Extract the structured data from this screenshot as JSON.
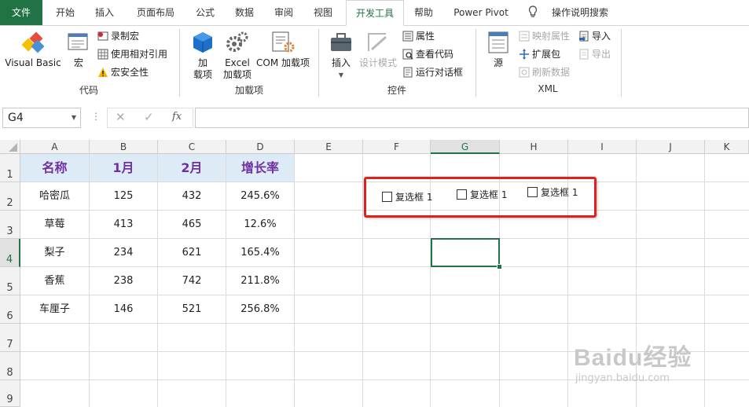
{
  "tabs": [
    {
      "label": "文件"
    },
    {
      "label": "开始"
    },
    {
      "label": "插入"
    },
    {
      "label": "页面布局"
    },
    {
      "label": "公式"
    },
    {
      "label": "数据"
    },
    {
      "label": "审阅"
    },
    {
      "label": "视图"
    },
    {
      "label": "开发工具"
    },
    {
      "label": "帮助"
    },
    {
      "label": "Power Pivot"
    }
  ],
  "tell_me": "操作说明搜索",
  "ribbon": {
    "code": {
      "group_label": "代码",
      "visual_basic": "Visual Basic",
      "macros": "宏",
      "record_macro": "录制宏",
      "relative_ref": "使用相对引用",
      "macro_security": "宏安全性"
    },
    "addins": {
      "group_label": "加载项",
      "addins_line1": "加",
      "addins_line2": "载项",
      "excel_line1": "Excel",
      "excel_line2": "加载项",
      "com": "COM 加载项"
    },
    "controls": {
      "group_label": "控件",
      "insert": "插入",
      "design_mode": "设计模式",
      "properties": "属性",
      "view_code": "查看代码",
      "run_dialog": "运行对话框"
    },
    "xml": {
      "group_label": "XML",
      "source": "源",
      "map_props": "映射属性",
      "expansion": "扩展包",
      "refresh": "刷新数据",
      "import": "导入",
      "export": "导出"
    }
  },
  "name_box": "G4",
  "formula": "",
  "fx": "fx",
  "columns": [
    "A",
    "B",
    "C",
    "D",
    "E",
    "F",
    "G",
    "H",
    "I",
    "J",
    "K"
  ],
  "rows": [
    "1",
    "2",
    "3",
    "4",
    "5",
    "6",
    "7",
    "8",
    "9"
  ],
  "table": {
    "headers": [
      "名称",
      "1月",
      "2月",
      "增长率"
    ],
    "rows": [
      [
        "哈密瓜",
        "125",
        "432",
        "245.6%"
      ],
      [
        "草莓",
        "413",
        "465",
        "12.6%"
      ],
      [
        "梨子",
        "234",
        "621",
        "165.4%"
      ],
      [
        "香蕉",
        "238",
        "742",
        "211.8%"
      ],
      [
        "车厘子",
        "146",
        "521",
        "256.8%"
      ]
    ]
  },
  "checkboxes": [
    "复选框 1",
    "复选框 1",
    "复选框 1"
  ],
  "watermark": "Baidu经验",
  "watermark_url": "jingyan.baidu.com"
}
